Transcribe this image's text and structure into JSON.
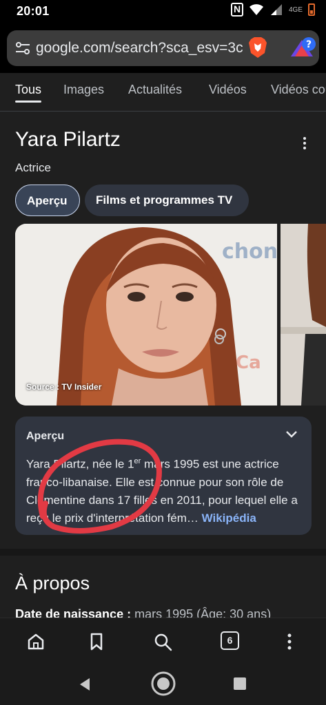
{
  "status": {
    "time": "20:01",
    "network": "4GE"
  },
  "browser": {
    "url": "google.com/search?sca_esv=3c",
    "tab_count": "6"
  },
  "tabs": [
    "Tous",
    "Images",
    "Actualités",
    "Vidéos",
    "Vidéos courtes"
  ],
  "knowledge": {
    "title": "Yara Pilartz",
    "subtitle": "Actrice",
    "chips": [
      "Aperçu",
      "Films et programmes TV"
    ],
    "image_source": "Source : TV Insider",
    "overview": {
      "title": "Aperçu",
      "text_a": "Yara Pilartz, née le 1",
      "text_sup": "er",
      "text_b": " mars 1995 est une actrice franco-libanaise. Elle est connue pour son rôle de Clémentine dans 17 filles en 2011, pour lequel elle a reçu le prix d'interprétation fém… ",
      "link": "Wikipédia"
    }
  },
  "about": {
    "title": "À propos",
    "birth_label": "Date de naissance :",
    "birth_value": " mars 1995 (Âge: 30 ans)"
  },
  "colors": {
    "link": "#8ab4f8",
    "annotation": "#e23a44",
    "chip_active_bg": "#394457"
  }
}
